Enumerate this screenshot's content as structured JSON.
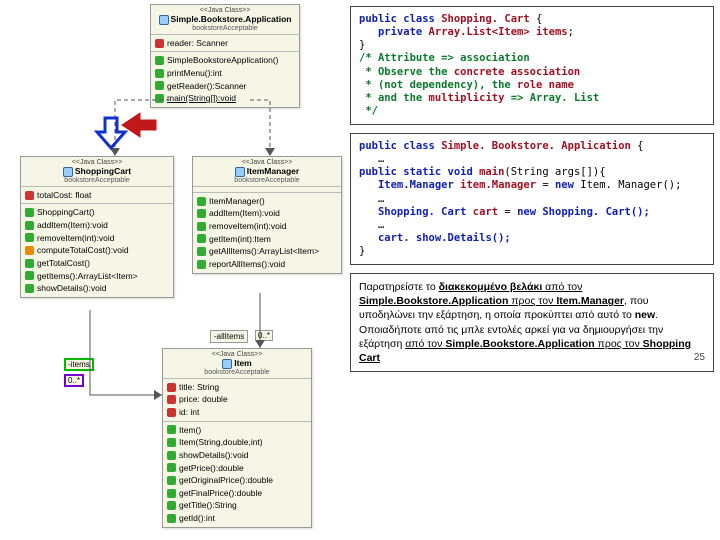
{
  "page_number": "25",
  "uml": {
    "app": {
      "stereo": "<<Java Class>>",
      "name": "Simple.Bookstore.Application",
      "pkg": "bookstoreAcceptable",
      "attrs": [
        "reader: Scanner"
      ],
      "ops": [
        "SimpleBookstoreApplication()",
        "printMenu():int",
        "getReader():Scanner",
        "main(String[]):void"
      ]
    },
    "cart": {
      "stereo": "<<Java Class>>",
      "name": "ShoppingCart",
      "pkg": "bookstoreAcceptable",
      "attrs": [
        "totalCost: float"
      ],
      "ops": [
        "ShoppingCart()",
        "addItem(Item):void",
        "removeItem(int):void",
        "computeTotalCost():void",
        "getTotalCost()",
        "getItems():ArrayList<Item>",
        "showDetails():void"
      ]
    },
    "mgr": {
      "stereo": "<<Java Class>>",
      "name": "ItemManager",
      "pkg": "bookstoreAcceptable",
      "ops": [
        "ItemManager()",
        "addItem(Item):void",
        "removeItem(int):void",
        "getItem(int):Item",
        "getAllItems():ArrayList<Item>",
        "reportAllItems():void"
      ]
    },
    "item": {
      "stereo": "<<Java Class>>",
      "name": "Item",
      "pkg": "bookstoreAcceptable",
      "attrs": [
        "title: String",
        "price: double",
        "id: int"
      ],
      "ops": [
        "Item()",
        "Item(String,double,int)",
        "showDetails():void",
        "getPrice():double",
        "getOriginalPrice():double",
        "getFinalPrice():double",
        "getTitle():String",
        "getId():int"
      ]
    },
    "labels": {
      "allItems": "-allItems",
      "items": "-items",
      "mult": "0..*"
    }
  },
  "code1": {
    "l1a": "public class ",
    "l1b": "Shopping. Cart",
    "l1c": " {",
    "l2a": "   private ",
    "l2b": "Array.List<Item> items",
    "l2c": ";",
    "l3": "}",
    "l4": "/* Attribute => association",
    "l5a": " * Observe the ",
    "l5b": "concrete association",
    "l6a": " * (not dependency), the ",
    "l6b": "role name",
    "l7a": " * and the ",
    "l7b": "multiplicity",
    "l7c": " => Array. List",
    "l8": " */"
  },
  "code2": {
    "l1a": "public class ",
    "l1b": "Simple. Bookstore. Application",
    "l1c": " {",
    "l2": "   …",
    "l3a": "public static void ",
    "l3b": "main",
    "l3c": "(String args[]){",
    "l4a": "   Item.Manager ",
    "l4b": "item.Manager",
    "l4c": " = ",
    "l4d": "new",
    "l4e": " Item. Manager();",
    "l5": "   …",
    "l6a": "   Shopping. Cart ",
    "l6b": "cart",
    "l6c": " = ",
    "l6d": "new",
    "l6e": " Shopping. Cart();",
    "l7": "   …",
    "l8a": "   cart. ",
    "l8b": "show.Details",
    "l8c": "();",
    "l9": "}"
  },
  "para": {
    "t1": "Παρατηρείστε το ",
    "t2": "διακεκομμένο βελάκι",
    "t3": " από τον ",
    "t4": "Simple.Bookstore.Application",
    "t5": " προς τον ",
    "t6": "Item.Manager",
    "t7": ", που υποδηλώνει την εξάρτηση, η οποία προκύπτει από αυτό το ",
    "t8": "new",
    "t9": ".",
    "t10": "Οποιαδήποτε από τις μπλε εντολές αρκεί για να δημιουργήσει την εξάρτηση ",
    "t11": "από τον",
    "t12": " Simple.Bookstore.Application ",
    "t13": "προς τον",
    "t14": " Shopping Cart"
  }
}
